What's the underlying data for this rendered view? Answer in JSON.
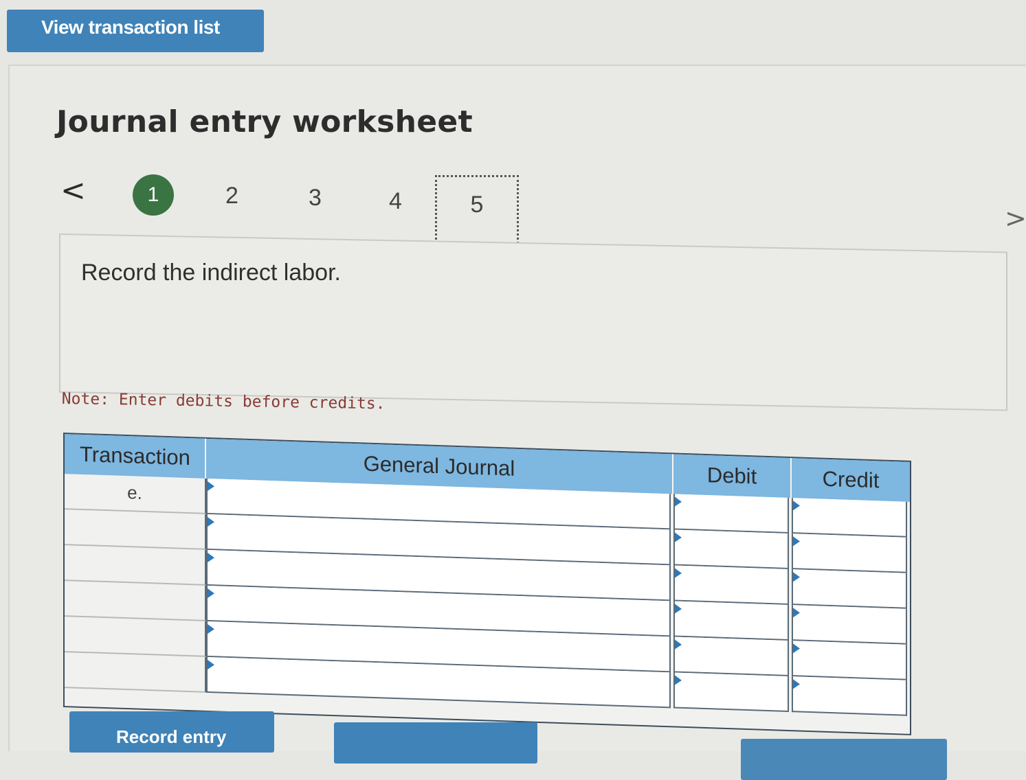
{
  "top_button": {
    "label": "View transaction list"
  },
  "title": "Journal entry worksheet",
  "steps": {
    "prev_glyph": "<",
    "next_glyph": ">",
    "items": [
      "1",
      "2",
      "3",
      "4",
      "5"
    ],
    "active": "1"
  },
  "instruction": "Record the indirect labor.",
  "note": "Note: Enter debits before credits.",
  "table": {
    "headers": {
      "transaction": "Transaction",
      "general_journal": "General Journal",
      "debit": "Debit",
      "credit": "Credit"
    },
    "rows": [
      {
        "transaction": "e.",
        "account": "",
        "debit": "",
        "credit": ""
      },
      {
        "transaction": "",
        "account": "",
        "debit": "",
        "credit": ""
      },
      {
        "transaction": "",
        "account": "",
        "debit": "",
        "credit": ""
      },
      {
        "transaction": "",
        "account": "",
        "debit": "",
        "credit": ""
      },
      {
        "transaction": "",
        "account": "",
        "debit": "",
        "credit": ""
      },
      {
        "transaction": "",
        "account": "",
        "debit": "",
        "credit": ""
      }
    ]
  },
  "buttons": {
    "record_entry": "Record entry",
    "clear_entry": "",
    "view_general_journal": ""
  },
  "colors": {
    "button_blue": "#3f83b8",
    "header_blue": "#7eb7e0",
    "active_step_green": "#3a7443",
    "note_red": "#8a3b33"
  }
}
